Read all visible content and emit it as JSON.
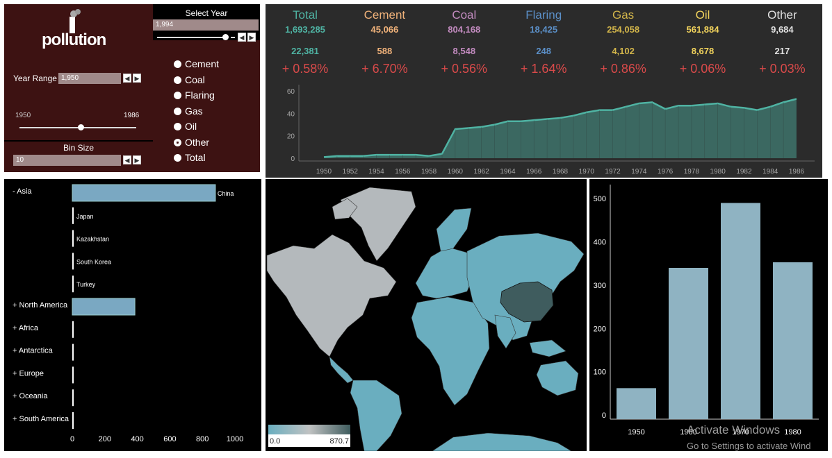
{
  "control": {
    "logo_text": "pollution",
    "select_year_label": "Select Year",
    "select_year_value": "1,994",
    "year_range_label": "Year Range",
    "year_range_value": "1,950",
    "range_min": "1950",
    "range_max": "1986",
    "bin_size_label": "Bin Size",
    "bin_size_value": "10",
    "radio_options": [
      "Cement",
      "Coal",
      "Flaring",
      "Gas",
      "Oil",
      "Other",
      "Total"
    ],
    "radio_selected": "Other"
  },
  "stats": {
    "columns": [
      {
        "name": "Total",
        "value": "1,693,285",
        "delta": "22,381",
        "pct": "+ 0.58%",
        "color": "#4fb3a3"
      },
      {
        "name": "Cement",
        "value": "45,066",
        "delta": "588",
        "pct": "+ 6.70%",
        "color": "#f0b27a"
      },
      {
        "name": "Coal",
        "value": "804,168",
        "delta": "8,548",
        "pct": "+ 0.56%",
        "color": "#c28bbf"
      },
      {
        "name": "Flaring",
        "value": "18,425",
        "delta": "248",
        "pct": "+ 1.64%",
        "color": "#5b8fc7"
      },
      {
        "name": "Gas",
        "value": "254,058",
        "delta": "4,102",
        "pct": "+ 0.86%",
        "color": "#d1b44a"
      },
      {
        "name": "Oil",
        "value": "561,884",
        "delta": "8,678",
        "pct": "+ 0.06%",
        "color": "#f2d35c"
      },
      {
        "name": "Other",
        "value": "9,684",
        "delta": "217",
        "pct": "+ 0.03%",
        "color": "#e0e0e0"
      }
    ]
  },
  "chart_data": [
    {
      "type": "area",
      "x": [
        1950,
        1951,
        1952,
        1953,
        1954,
        1955,
        1956,
        1957,
        1958,
        1959,
        1960,
        1961,
        1962,
        1963,
        1964,
        1965,
        1966,
        1967,
        1968,
        1969,
        1970,
        1971,
        1972,
        1973,
        1974,
        1975,
        1976,
        1977,
        1978,
        1979,
        1980,
        1981,
        1982,
        1983,
        1984,
        1985,
        1986
      ],
      "values": [
        1,
        2,
        2,
        2,
        3,
        3,
        3,
        3,
        2,
        4,
        26,
        27,
        28,
        30,
        33,
        33,
        34,
        35,
        36,
        38,
        41,
        43,
        43,
        46,
        49,
        50,
        44,
        47,
        47,
        48,
        49,
        46,
        45,
        43,
        46,
        50,
        53
      ],
      "xticks": [
        "1950",
        "1952",
        "1954",
        "1956",
        "1958",
        "1960",
        "1962",
        "1964",
        "1966",
        "1968",
        "1970",
        "1972",
        "1974",
        "1976",
        "1978",
        "1980",
        "1982",
        "1984",
        "1986"
      ],
      "yticks": [
        "0",
        "20",
        "40",
        "60"
      ],
      "ylim": [
        0,
        62
      ],
      "color": "#4fb3a3"
    },
    {
      "type": "bar",
      "orientation": "horizontal",
      "groups": [
        "- Asia",
        "+ North America",
        "+ Africa",
        "+ Antarctica",
        "+ Europe",
        "+ Oceania",
        "+ South America"
      ],
      "rows": [
        {
          "group": "- Asia",
          "label": "China",
          "value": 880
        },
        {
          "group": "",
          "label": "Japan",
          "value": 5
        },
        {
          "group": "",
          "label": "Kazakhstan",
          "value": 5
        },
        {
          "group": "",
          "label": "South Korea",
          "value": 5
        },
        {
          "group": "",
          "label": "Turkey",
          "value": 5
        },
        {
          "group": "+ North America",
          "label": "",
          "value": 385
        },
        {
          "group": "+ Africa",
          "label": "",
          "value": 5
        },
        {
          "group": "+ Antarctica",
          "label": "",
          "value": 5
        },
        {
          "group": "+ Europe",
          "label": "",
          "value": 5
        },
        {
          "group": "+ Oceania",
          "label": "",
          "value": 5
        },
        {
          "group": "+ South America",
          "label": "",
          "value": 5
        }
      ],
      "xticks": [
        "0",
        "200",
        "400",
        "600",
        "800",
        "1000"
      ],
      "xlim": [
        0,
        1000
      ],
      "color": "#7aa8c2"
    },
    {
      "type": "bar",
      "categories": [
        "1950",
        "1960",
        "1970",
        "1980"
      ],
      "values": [
        62,
        340,
        490,
        353
      ],
      "yticks": [
        "0",
        "100",
        "200",
        "300",
        "400",
        "500"
      ],
      "ylim": [
        0,
        510
      ],
      "color": "#8fb3c2"
    }
  ],
  "map": {
    "legend_min": "0.0",
    "legend_max": "870.7"
  },
  "watermark": {
    "line1": "Activate Windows",
    "line2": "Go to Settings to activate Wind"
  }
}
